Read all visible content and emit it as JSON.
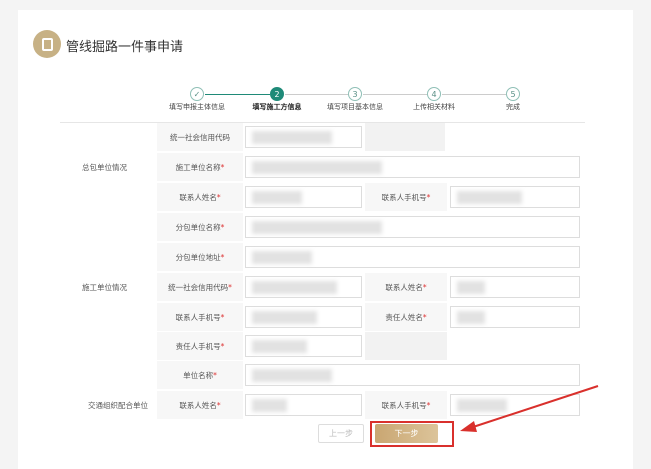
{
  "header": {
    "title": "管线掘路一件事申请",
    "icon": "clipboard-icon"
  },
  "steps": [
    {
      "num": "✓",
      "label": "填写申报主体信息",
      "state": "done"
    },
    {
      "num": "2",
      "label": "填写施工方信息",
      "state": "active"
    },
    {
      "num": "3",
      "label": "填写项目基本信息",
      "state": "pending"
    },
    {
      "num": "4",
      "label": "上传相关材料",
      "state": "pending"
    },
    {
      "num": "5",
      "label": "完成",
      "state": "pending"
    }
  ],
  "sections": {
    "general": "总包单位情况",
    "construction": "施工单位情况",
    "traffic": "交通组织配合单位"
  },
  "labels": {
    "credit_code": "统一社会信用代码",
    "construction_unit_name": "施工单位名称",
    "contact_name": "联系人姓名",
    "contact_phone": "联系人手机号",
    "sub_unit_name": "分包单位名称",
    "sub_unit_address": "分包单位地址",
    "responsible_name": "责任人姓名",
    "responsible_phone": "责任人手机号",
    "unit_name": "单位名称",
    "required_mark": "*"
  },
  "buttons": {
    "prev": "上一步",
    "next": "下一步"
  },
  "colors": {
    "accent": "#1f8a78",
    "gold": "#c7a871",
    "highlight": "#d9302c"
  }
}
